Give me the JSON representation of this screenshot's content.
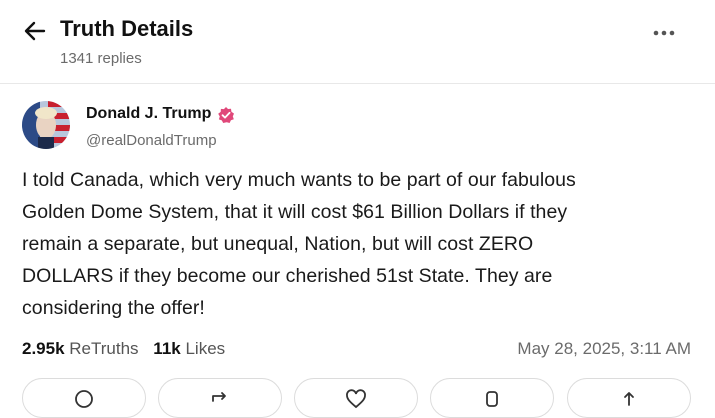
{
  "header": {
    "title": "Truth Details",
    "replies": "1341 replies"
  },
  "post": {
    "author_name": "Donald J. Trump",
    "author_handle": "@realDonaldTrump",
    "body_lines": [
      "I told Canada, which very much wants to be part of our fabulous",
      "Golden Dome System, that it will cost $61 Billion Dollars if they",
      "remain a separate, but unequal, Nation, but will cost ZERO",
      "DOLLARS if they become our cherished 51st State. They are",
      "considering the offer!"
    ],
    "retruths_count": "2.95k",
    "retruths_label": "ReTruths",
    "likes_count": "11k",
    "likes_label": "Likes",
    "timestamp": "May 28, 2025, 3:11 AM"
  },
  "icons": {
    "back": "arrow-left-icon",
    "more": "more-horizontal-icon",
    "verified": "verified-badge-icon",
    "reply": "comment-icon",
    "retruth": "retruth-icon",
    "like": "heart-icon",
    "bookmark": "bookmark-icon",
    "share": "share-icon"
  },
  "colors": {
    "verified": "#e0487a",
    "text": "#111111",
    "muted": "#6b6b6b"
  }
}
